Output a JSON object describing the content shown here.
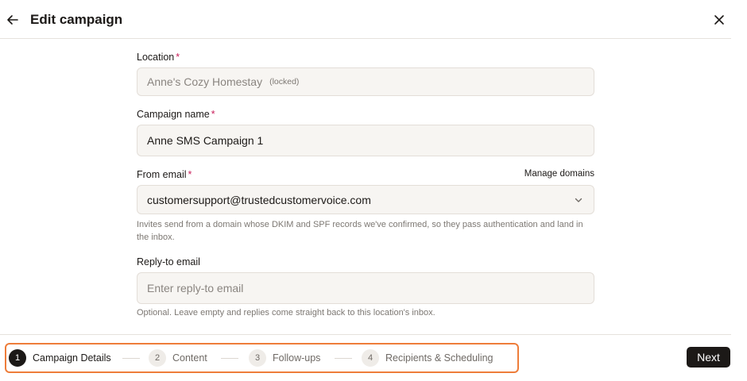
{
  "header": {
    "title": "Edit campaign",
    "back_icon": "arrow-left-icon",
    "close_icon": "close-icon"
  },
  "form": {
    "location": {
      "label": "Location",
      "required_mark": "*",
      "value": "Anne's Cozy Homestay",
      "tag": "(locked)"
    },
    "campaign_name": {
      "label": "Campaign name",
      "required_mark": "*",
      "value": "Anne SMS Campaign 1"
    },
    "from_email": {
      "label": "From email",
      "required_mark": "*",
      "manage_link": "Manage domains",
      "value": "customersupport@trustedcustomervoice.com",
      "help": "Invites send from a domain whose DKIM and SPF records we've confirmed, so they pass authentication and land in the inbox."
    },
    "reply_to": {
      "label": "Reply-to email",
      "value": "",
      "placeholder": "Enter reply-to email",
      "help": "Optional. Leave empty and replies come straight back to this location's inbox."
    }
  },
  "stepper": {
    "steps": [
      {
        "number": "1",
        "label": "Campaign Details",
        "active": true
      },
      {
        "number": "2",
        "label": "Content",
        "active": false
      },
      {
        "number": "3",
        "label": "Follow-ups",
        "active": false
      },
      {
        "number": "4",
        "label": "Recipients & Scheduling",
        "active": false
      }
    ]
  },
  "footer": {
    "next_label": "Next"
  },
  "colors": {
    "accent_outline": "#ee7d3a",
    "required": "#c81e5a",
    "primary_button": "#1c1917"
  }
}
